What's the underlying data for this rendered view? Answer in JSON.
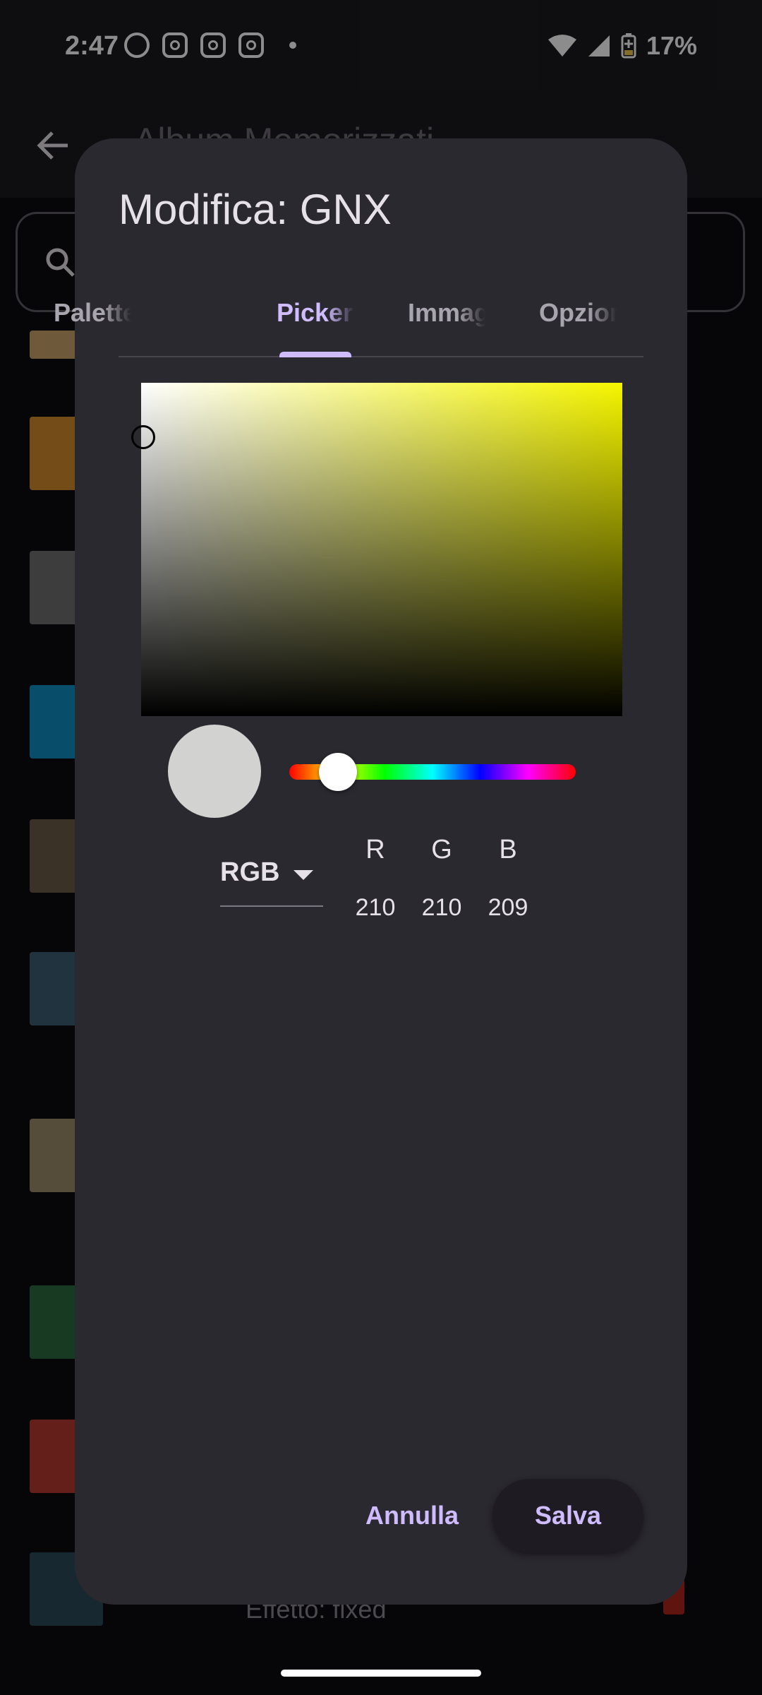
{
  "status_bar": {
    "time": "2:47",
    "battery": "17%",
    "notification_icons": [
      "whatsapp-icon",
      "instagram-icon",
      "instagram-icon",
      "instagram-icon"
    ]
  },
  "background": {
    "title": "Album Memorizzati",
    "item_subtitle": "Effetto: fixed"
  },
  "dialog": {
    "title": "Modifica: GNX",
    "tabs": [
      {
        "label": "Palette"
      },
      {
        "label": "Picker"
      },
      {
        "label": "Immagine"
      },
      {
        "label": "Opzioni"
      }
    ],
    "active_tab": "Picker",
    "picker": {
      "hue_color": "#f5f500",
      "preview_color": "#d2d2d1",
      "hue_position": 0.17,
      "mode": "RGB",
      "channels": [
        {
          "label": "R",
          "value": "210"
        },
        {
          "label": "G",
          "value": "210"
        },
        {
          "label": "B",
          "value": "209"
        }
      ]
    },
    "cancel_label": "Annulla",
    "save_label": "Salva"
  },
  "colors": {
    "accent": "#cfbcff",
    "dialog_bg": "#2b2930"
  }
}
